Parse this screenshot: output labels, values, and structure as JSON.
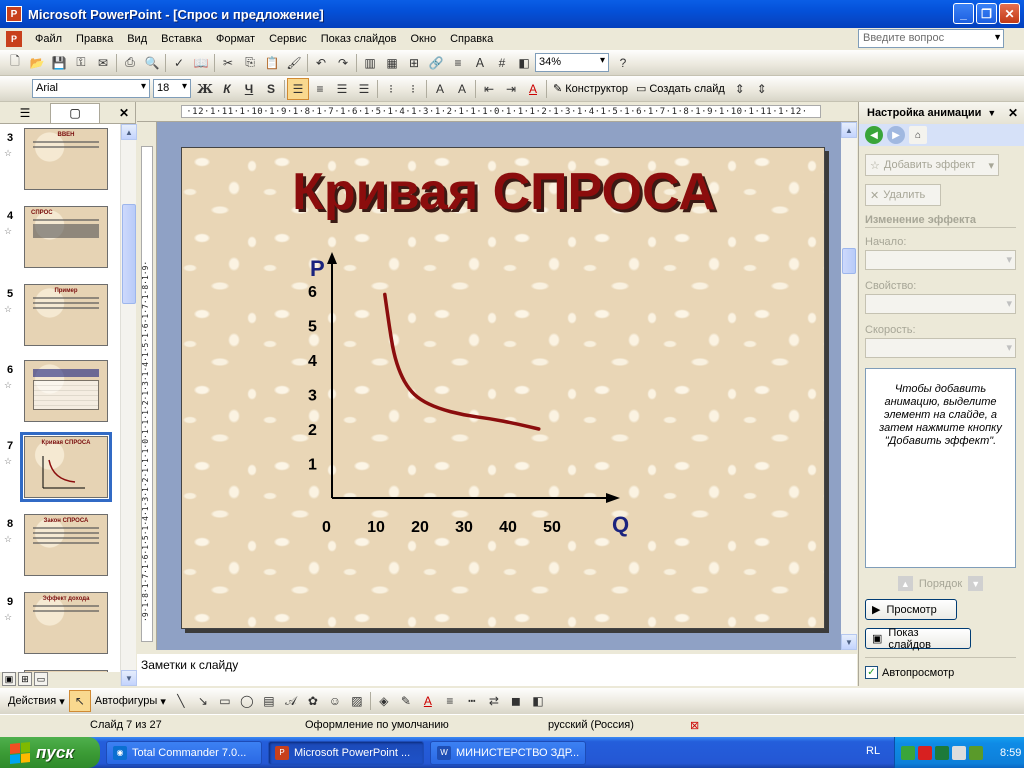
{
  "window": {
    "title": "Microsoft PowerPoint - [Спрос и предложение]"
  },
  "menu": {
    "items": [
      "Файл",
      "Правка",
      "Вид",
      "Вставка",
      "Формат",
      "Сервис",
      "Показ слайдов",
      "Окно",
      "Справка"
    ],
    "help_placeholder": "Введите вопрос"
  },
  "toolbar_standard": {
    "zoom": "34%"
  },
  "toolbar_format": {
    "font": "Arial",
    "size": "18",
    "bold": "Ж",
    "italic": "К",
    "underline": "Ч",
    "shadow": "S",
    "designer": "Конструктор",
    "new_slide": "Создать слайд"
  },
  "ruler": {
    "horizontal": "·12·1·11·1·10·1·9·1·8·1·7·1·6·1·5·1·4·1·3·1·2·1·1·1·0·1·1·1·2·1·3·1·4·1·5·1·6·1·7·1·8·1·9·1·10·1·11·1·12·",
    "vertical": "·9·1·8·1·7·1·6·1·5·1·4·1·3·1·2·1·1·1·0·1·1·1·2·1·3·1·4·1·5·1·6·1·7·1·8·1·9·"
  },
  "slides": [
    {
      "num": "3",
      "title": "ВВЕН"
    },
    {
      "num": "4",
      "title": "СПРОС"
    },
    {
      "num": "5",
      "title": "Пример"
    },
    {
      "num": "6",
      "title": ""
    },
    {
      "num": "7",
      "title": "Кривая СПРОСА"
    },
    {
      "num": "8",
      "title": "Закон СПРОСА"
    },
    {
      "num": "9",
      "title": "Эффект дохода"
    },
    {
      "num": "10",
      "title": ""
    }
  ],
  "slide": {
    "title": "Кривая СПРОСА"
  },
  "chart_data": {
    "type": "line",
    "title": "",
    "xlabel": "Q",
    "ylabel": "P",
    "x_ticks": [
      "0",
      "10",
      "20",
      "30",
      "40",
      "50"
    ],
    "y_ticks": [
      "1",
      "2",
      "3",
      "4",
      "5",
      "6"
    ],
    "xlim": [
      0,
      60
    ],
    "ylim": [
      0,
      6.5
    ],
    "series": [
      {
        "color": "#8b0d0d",
        "points": [
          [
            12,
            5.9
          ],
          [
            13,
            5.0
          ],
          [
            14,
            4.2
          ],
          [
            15.5,
            3.6
          ],
          [
            17.5,
            3.15
          ],
          [
            20,
            2.85
          ],
          [
            24,
            2.6
          ],
          [
            30,
            2.4
          ],
          [
            36,
            2.3
          ],
          [
            42,
            2.15
          ],
          [
            47,
            2.0
          ]
        ]
      }
    ],
    "grid": false,
    "colors": {
      "axis": "#000000",
      "axis_label": "#1a237e",
      "curve": "#8b0d0d"
    }
  },
  "notes": {
    "placeholder": "Заметки к слайду"
  },
  "task_pane": {
    "title": "Настройка анимации",
    "add_effect": "Добавить эффект",
    "remove": "Удалить",
    "change_effect": "Изменение эффекта",
    "start_label": "Начало:",
    "property_label": "Свойство:",
    "speed_label": "Скорость:",
    "hint": "Чтобы добавить анимацию, выделите элемент на слайде, а затем нажмите кнопку \"Добавить эффект\".",
    "order": "Порядок",
    "preview": "Просмотр",
    "slideshow": "Показ слайдов",
    "autopreview": "Автопросмотр"
  },
  "drawing_toolbar": {
    "actions": "Действия",
    "autoshapes": "Автофигуры"
  },
  "status": {
    "slide": "Слайд 7 из 27",
    "design": "Оформление по умолчанию",
    "language": "русский (Россия)"
  },
  "taskbar": {
    "start": "пуск",
    "tasks": [
      "Total Commander 7.0...",
      "Microsoft PowerPoint ...",
      "МИНИСТЕРСТВО ЗДР..."
    ],
    "lang": "RL",
    "time": "8:59"
  }
}
